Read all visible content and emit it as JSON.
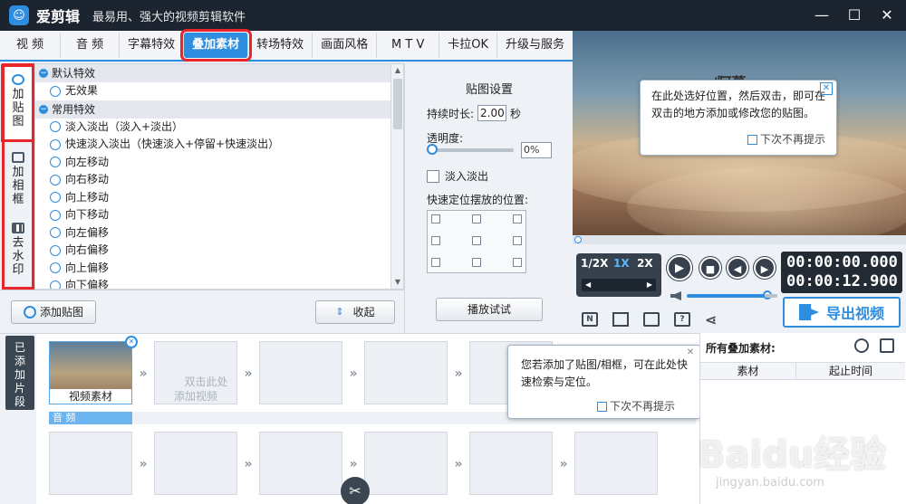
{
  "app": {
    "name": "爱剪辑",
    "slogan": "最易用、强大的视频剪辑软件"
  },
  "tabs": [
    "视 频",
    "音 频",
    "字幕特效",
    "叠加素材",
    "转场特效",
    "画面风格",
    "M T V",
    "卡拉OK",
    "升级与服务"
  ],
  "active_tab": "叠加素材",
  "side_tabs": [
    {
      "label": "加\n贴\n图",
      "icon": "sticker-icon",
      "active": true
    },
    {
      "label": "加\n相\n框",
      "icon": "frame-icon",
      "active": false
    },
    {
      "label": "去\n水\n印",
      "icon": "mosaic-icon",
      "active": false
    }
  ],
  "effects": {
    "default_group": "默认特效",
    "default_items": [
      "无效果"
    ],
    "common_group": "常用特效",
    "common_items": [
      "淡入淡出（淡入+淡出）",
      "快速淡入淡出（快速淡入+停留+快速淡出）",
      "向左移动",
      "向右移动",
      "向上移动",
      "向下移动",
      "向左偏移",
      "向右偏移",
      "向上偏移",
      "向下偏移"
    ]
  },
  "list_footer": {
    "add_sticker": "添加贴图",
    "collapse": "收起"
  },
  "settings": {
    "title": "贴图设置",
    "duration_label": "持续时长:",
    "duration_value": "2.00",
    "duration_unit": "秒",
    "opacity_label": "透明度:",
    "opacity_value": "0%",
    "opacity_level": 0,
    "fade_label": "淡入淡出",
    "position_label": "快速定位摆放的位置:",
    "preview_button": "播放试试"
  },
  "preview": {
    "watermark": "pansy/阿慕",
    "tip": "在此处选好位置，然后双击，即可在双击的地方添加或修改您的贴图。",
    "no_show": "下次不再提示"
  },
  "playback": {
    "speeds": [
      "1/2X",
      "1X",
      "2X"
    ],
    "active_speed": "1X",
    "current_time": "00:00:00.000",
    "total_time": "00:00:12.900",
    "volume_level": 0.85
  },
  "export_label": "导出视频",
  "timeline": {
    "label": "已\n添\n加\n片\n段",
    "clip_caption": "视频素材",
    "empty_clip": "双击此处\n添加视频",
    "audio_label": "音 频",
    "tip": "您若添加了贴图/相框，可在此处快速检索与定位。",
    "no_show": "下次不再提示"
  },
  "right_panel": {
    "title": "所有叠加素材:",
    "col_material": "素材",
    "col_start": "起止时间"
  },
  "watermark": {
    "brand": "Baidu经验",
    "url": "jingyan.baidu.com"
  }
}
